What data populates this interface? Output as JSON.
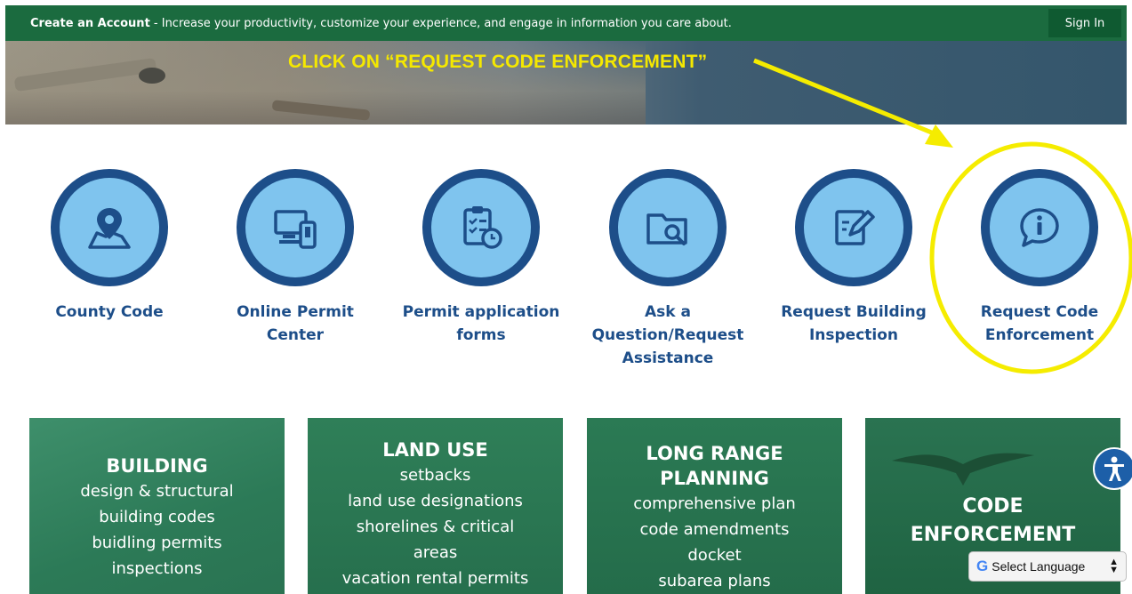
{
  "topbar": {
    "create_account": "Create an Account",
    "message": " - Increase your productivity, customize your experience, and engage in information you care about.",
    "sign_in": "Sign In"
  },
  "hero": {
    "annotation": "CLICK ON “REQUEST CODE ENFORCEMENT”"
  },
  "quick_links": [
    {
      "label": "County Code",
      "icon": "map-pin-icon"
    },
    {
      "label": "Online Permit Center",
      "icon": "devices-icon"
    },
    {
      "label": "Permit application forms",
      "icon": "clipboard-clock-icon"
    },
    {
      "label": "Ask a Question/Request Assistance",
      "icon": "folder-search-icon"
    },
    {
      "label": "Request Building Inspection",
      "icon": "edit-document-icon"
    },
    {
      "label": "Request Code Enforcement",
      "icon": "info-chat-icon"
    }
  ],
  "tiles": [
    {
      "title": "BUILDING",
      "lines": [
        "design & structural",
        "building codes",
        "buidling permits",
        "inspections"
      ]
    },
    {
      "title": "LAND USE",
      "lines": [
        "setbacks",
        "land use designations",
        "shorelines & critical",
        "areas",
        "vacation rental permits"
      ]
    },
    {
      "title": "LONG RANGE PLANNING",
      "title2": "PLANNING",
      "title1": "LONG RANGE",
      "lines": [
        "comprehensive plan",
        "code amendments",
        "docket",
        "subarea plans"
      ]
    },
    {
      "title1": "CODE",
      "title2": "ENFORCEMENT"
    }
  ],
  "widgets": {
    "language_select": "Select Language",
    "accessibility_icon": "accessibility-icon"
  },
  "colors": {
    "topbar": "#1b6b3f",
    "circle_ring": "#1d4e89",
    "circle_fill": "#7fc4ee",
    "annotation": "#f5e800",
    "tile_green": "#2a7352"
  }
}
